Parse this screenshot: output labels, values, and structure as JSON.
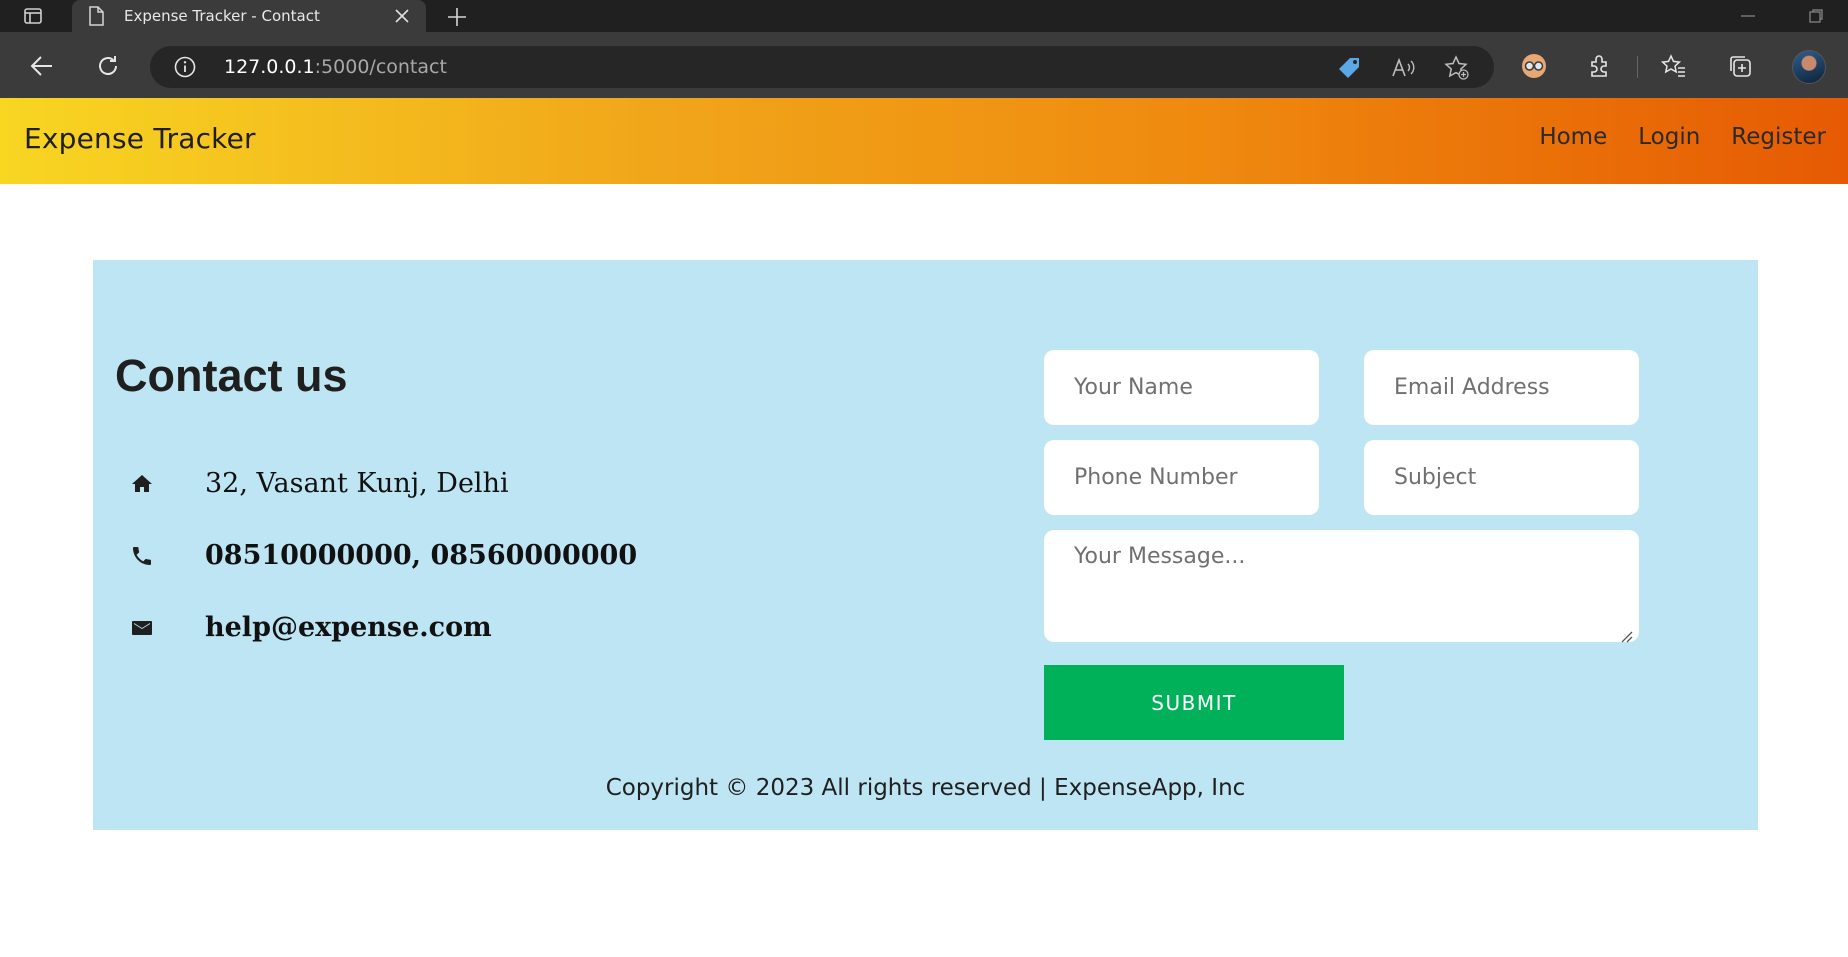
{
  "browser": {
    "tab": {
      "title": "Expense Tracker - Contact",
      "icon": "page-icon"
    },
    "url": {
      "host": "127.0.0.1",
      "path": ":5000/contact"
    },
    "icons": [
      "sidebar-icon",
      "page-icon",
      "close-icon",
      "plus-icon",
      "minimize-icon",
      "restore-icon",
      "back-icon",
      "reload-icon",
      "info-icon",
      "tag-icon",
      "read-aloud-icon",
      "add-favorite-icon",
      "profile-glasses-icon",
      "extensions-icon",
      "favorites-icon",
      "collections-icon"
    ]
  },
  "navbar": {
    "brand": "Expense Tracker",
    "links": [
      "Home",
      "Login",
      "Register"
    ]
  },
  "contact": {
    "title": "Contact us",
    "address": "32, Vasant Kunj, Delhi",
    "phone": "08510000000, 08560000000",
    "email": "help@expense.com"
  },
  "form": {
    "name_placeholder": "Your Name",
    "email_placeholder": "Email Address",
    "phone_placeholder": "Phone Number",
    "subject_placeholder": "Subject",
    "message_placeholder": "Your Message...",
    "submit_label": "SUBMIT"
  },
  "footer": {
    "copyright": "Copyright © 2023 All rights reserved | ExpenseApp, Inc"
  },
  "colors": {
    "navbar_gradient_start": "#f8d622",
    "navbar_gradient_end": "#e65a03",
    "panel_bg": "#bee5f3",
    "submit_bg": "#00b159"
  }
}
